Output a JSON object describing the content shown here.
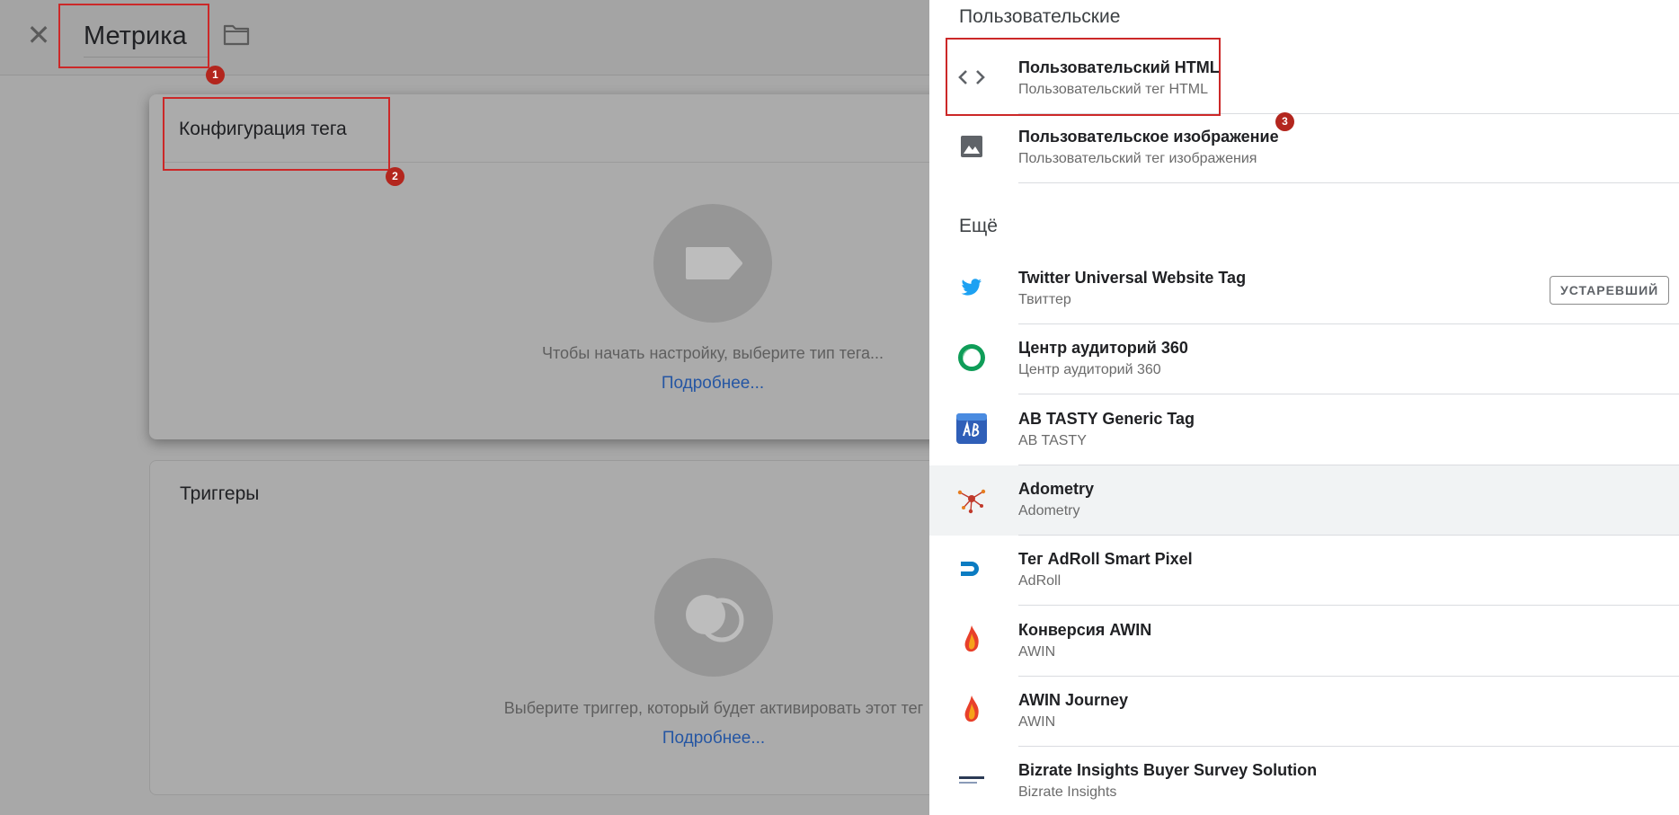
{
  "editor": {
    "tag_name": "Метрика",
    "config_card": {
      "title": "Конфигурация тега",
      "hint": "Чтобы начать настройку, выберите тип тега...",
      "link": "Подробнее..."
    },
    "triggers_card": {
      "title": "Триггеры",
      "hint": "Выберите триггер, который будет активировать этот тег",
      "link": "Подробнее..."
    }
  },
  "annotations": [
    "1",
    "2",
    "3"
  ],
  "panel": {
    "section_custom": "Пользовательские",
    "custom_items": [
      {
        "title": "Пользовательский HTML",
        "subtitle": "Пользовательский тег HTML",
        "icon": "code-icon"
      },
      {
        "title": "Пользовательское изображение",
        "subtitle": "Пользовательский тег изображения",
        "icon": "image-icon"
      }
    ],
    "section_more": "Ещё",
    "more_items": [
      {
        "title": "Twitter Universal Website Tag",
        "subtitle": "Твиттер",
        "badge": "УСТАРЕВШИЙ",
        "icon": "twitter-icon"
      },
      {
        "title": "Центр аудиторий 360",
        "subtitle": "Центр аудиторий 360",
        "icon": "audience-center-icon"
      },
      {
        "title": "AB TASTY Generic Tag",
        "subtitle": "AB TASTY",
        "icon": "ab-tasty-icon"
      },
      {
        "title": "Adometry",
        "subtitle": "Adometry",
        "icon": "adometry-icon"
      },
      {
        "title": "Тег AdRoll Smart Pixel",
        "subtitle": "AdRoll",
        "icon": "adroll-icon"
      },
      {
        "title": "Конверсия AWIN",
        "subtitle": "AWIN",
        "icon": "awin-icon"
      },
      {
        "title": "AWIN Journey",
        "subtitle": "AWIN",
        "icon": "awin-icon"
      },
      {
        "title": "Bizrate Insights Buyer Survey Solution",
        "subtitle": "Bizrate Insights",
        "icon": "bizrate-icon"
      }
    ]
  },
  "colors": {
    "annotation": "#cc2828",
    "link": "#2556a3",
    "twitter": "#1da1f2",
    "awin": "#e8402a"
  }
}
